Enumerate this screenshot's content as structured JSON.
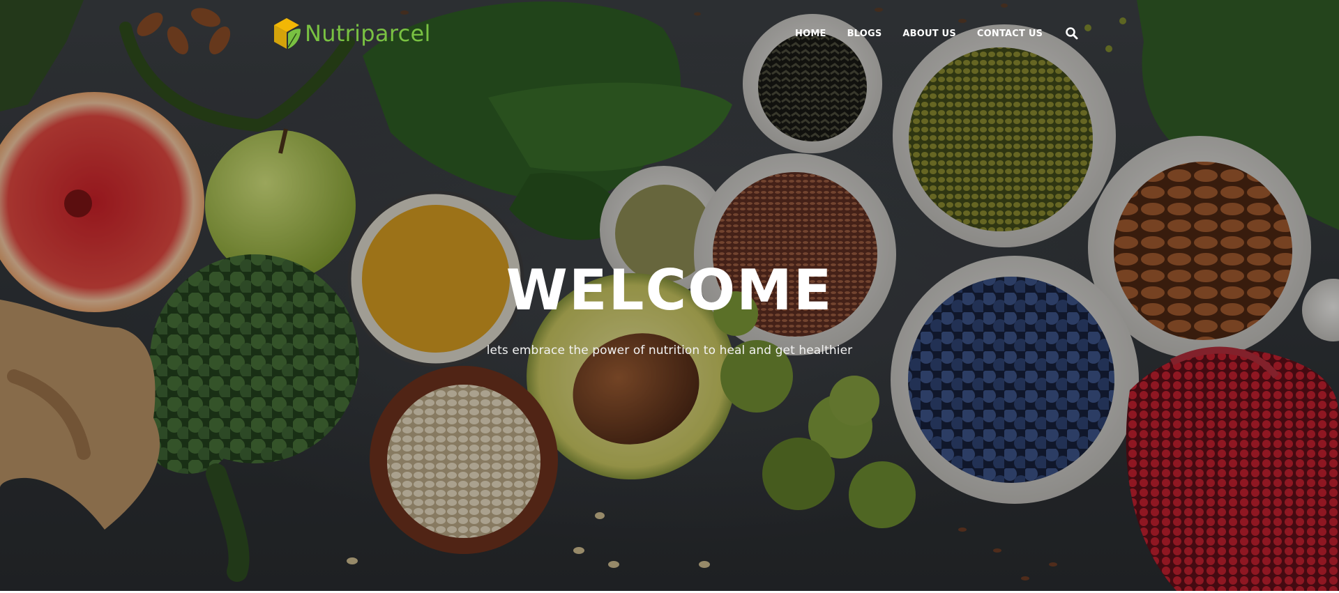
{
  "brand": {
    "name": "Nutriparcel",
    "accent_color": "#79c142",
    "mark_color": "#f2b705"
  },
  "nav": {
    "links": [
      {
        "label": "HOME"
      },
      {
        "label": "BLOGS"
      },
      {
        "label": "ABOUT US"
      },
      {
        "label": "CONTACT US"
      }
    ],
    "search_icon": "search-icon"
  },
  "hero": {
    "headline": "WELCOME",
    "tagline": "lets embrace the power of nutrition to heal and get healthier",
    "background": "photo of healthy foods: grapefruit, apple, spinach, turmeric, avocado, oats, broccoli, ginger, brussels sprouts, flax seeds, mung beans, almonds, blueberries, pomegranate"
  }
}
